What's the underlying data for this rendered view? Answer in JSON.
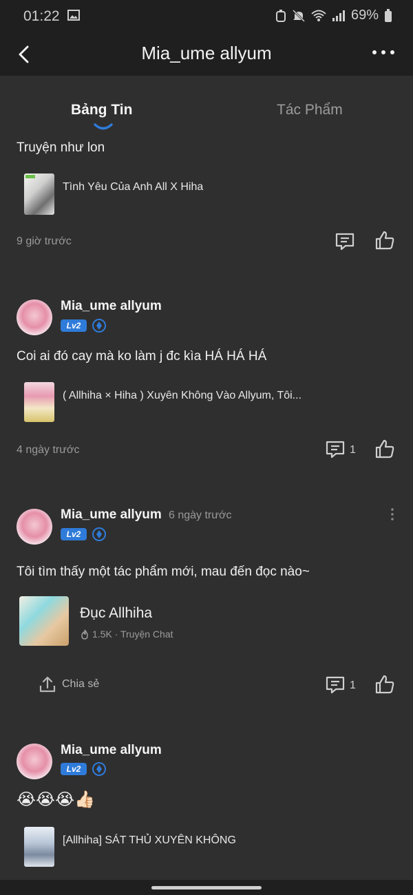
{
  "status_bar": {
    "time": "01:22",
    "battery": "69%",
    "icons": [
      "image-icon",
      "alarm-icon",
      "mute-icon",
      "wifi-icon",
      "signal-icon",
      "battery-icon"
    ]
  },
  "header": {
    "title": "Mia_ume allyum",
    "back_icon": "chevron-left-icon",
    "more_icon": "more-horizontal-icon"
  },
  "tabs": [
    {
      "label": "Bảng Tin",
      "active": true
    },
    {
      "label": "Tác Phẩm",
      "active": false
    }
  ],
  "posts": [
    {
      "text": "Truyện như lon",
      "work_title": "Tình Yêu Của Anh All X Hiha",
      "time": "9 giờ trước",
      "comment_count": ""
    },
    {
      "author": "Mia_ume allyum",
      "level": "Lv2",
      "text": "Coi ai đó cay mà ko làm j đc kìa HÁ HÁ HÁ",
      "work_title": "( Allhiha × Hiha ) Xuyên Không Vào Allyum, Tôi...",
      "time": "4 ngày trước",
      "comment_count": "1"
    },
    {
      "author": "Mia_ume allyum",
      "level": "Lv2",
      "author_time": "6 ngày trước",
      "text": "Tôi tìm thấy một tác phẩm mới, mau đến đọc nào~",
      "card_title": "Đục Allhiha",
      "card_meta": "1.5K · Truyện Chat",
      "share_label": "Chia sẻ",
      "comment_count": "1"
    },
    {
      "author": "Mia_ume allyum",
      "level": "Lv2",
      "emojis": "😭😭😭👍🏻",
      "work_title": "[Allhiha] SÁT THỦ XUYÊN KHÔNG"
    }
  ],
  "colors": {
    "background": "#2f2f2f",
    "bar": "#1f1f1f",
    "accent": "#2f7bd9",
    "text": "#f0f0f0",
    "muted": "#9a9a9a"
  }
}
